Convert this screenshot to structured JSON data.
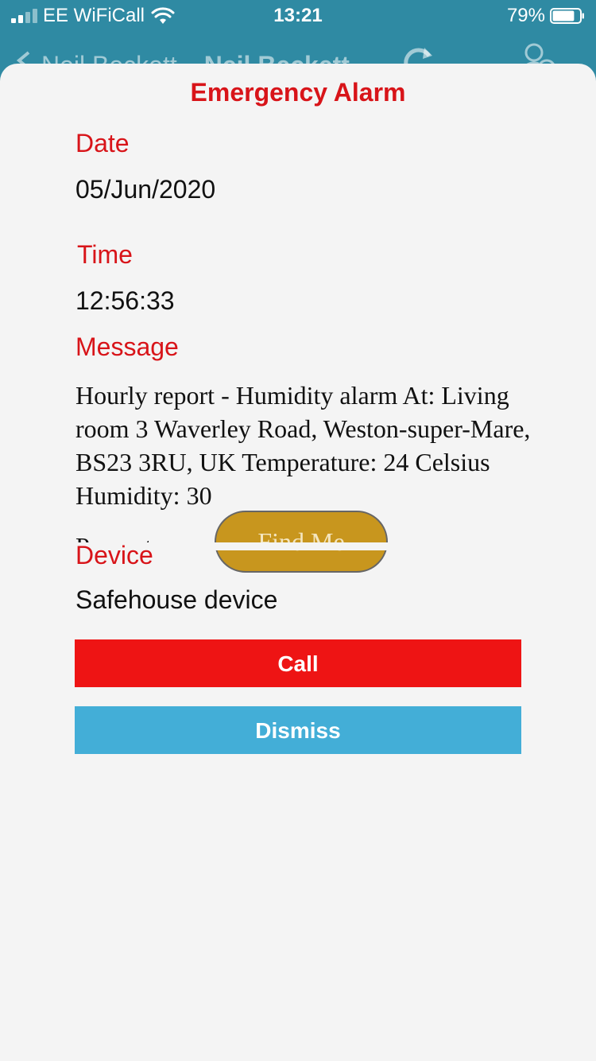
{
  "status_bar": {
    "carrier": "EE WiFiCall",
    "time": "13:21",
    "battery_percent": "79%",
    "battery_level": 0.79,
    "signal_bars": 2
  },
  "background_nav": {
    "back_label": "Neil Beckett",
    "title": "Neil Beckett"
  },
  "alarm": {
    "title": "Emergency Alarm",
    "date_label": "Date",
    "date_value": "05/Jun/2020",
    "time_label": "Time",
    "time_value": "12:56:33",
    "message_label": "Message",
    "message_value": "Hourly report - Humidity alarm At: Living room 3 Waverley Road, Weston-super-Mare, BS23 3RU, UK Temperature: 24 Celsius Humidity: 30",
    "message_overflow": "Percent",
    "find_me_label": "Find Me",
    "device_label": "Device",
    "device_value": "Safehouse device"
  },
  "actions": {
    "call_label": "Call",
    "dismiss_label": "Dismiss"
  },
  "colors": {
    "accent_red": "#d81419",
    "call_red": "#ee1414",
    "dismiss_blue": "#43aed7",
    "find_me_gold": "#c8961e",
    "nav_teal": "#2f8aa3"
  }
}
